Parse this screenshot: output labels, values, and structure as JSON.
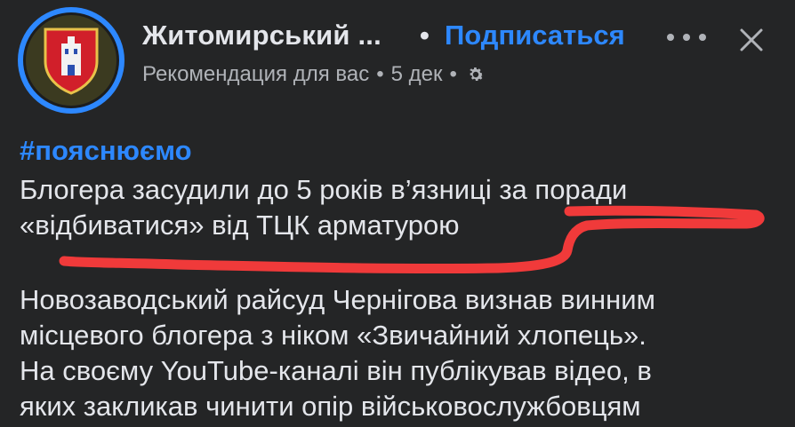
{
  "header": {
    "page_name": "Житомирський ...",
    "separator": "•",
    "follow_label": "Подписаться",
    "meta": {
      "recommendation": "Рекомендация для вас",
      "dot": "•",
      "date": "5 дек"
    },
    "icons": {
      "avatar": "coat-of-arms-icon",
      "more": "more-icon",
      "close": "close-icon",
      "audience": "gear-icon"
    }
  },
  "post": {
    "hashtag": "#пояснюємо",
    "headline_lines": [
      "Блогера засудили до 5 років в’язниці за поради",
      "«відбиватися» від ТЦК арматурою"
    ],
    "body_lines": [
      "Новозаводський райсуд Чернігова визнав винним",
      "місцевого блогера з ніком «Звичайний хлопець».",
      "На своєму YouTube-каналі він публікував відео, в",
      "яких закликав чинити опір військовослужбовцям"
    ]
  },
  "colors": {
    "background": "#242526",
    "text": "#e4e6eb",
    "secondary_text": "#b0b3b8",
    "link": "#2d88ff",
    "annotation": "#f03a3a"
  }
}
